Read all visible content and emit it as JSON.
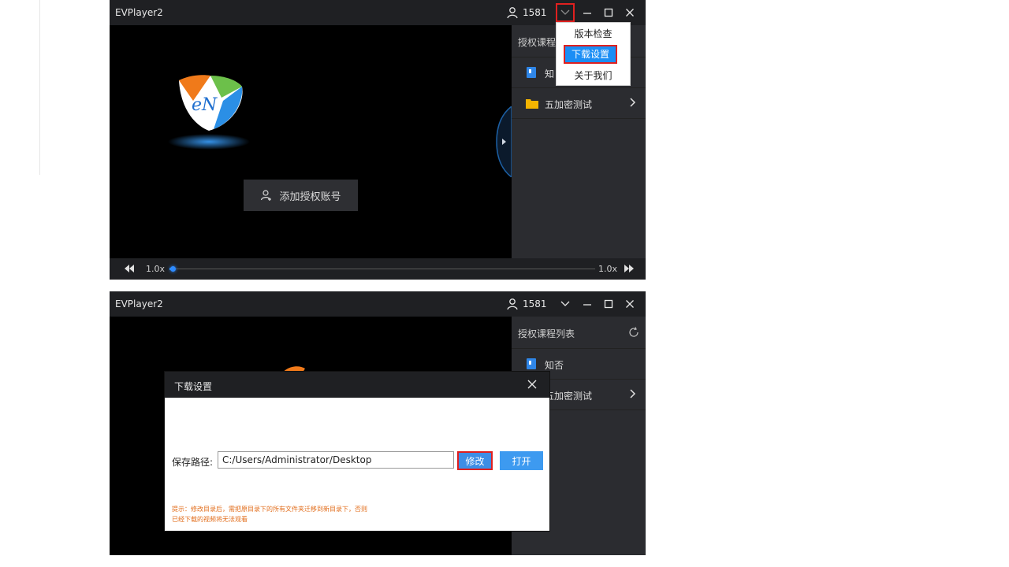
{
  "app": {
    "title": "EVPlayer2",
    "user_count": "1581"
  },
  "menu": {
    "items": [
      "版本检查",
      "下载设置",
      "关于我们"
    ]
  },
  "panel": {
    "title": "授权课程列表",
    "title_truncated": "授权课程",
    "items": [
      {
        "label": "知否",
        "label_truncated": "知",
        "icon": "book-icon"
      },
      {
        "label": "五加密测试",
        "icon": "folder-icon"
      }
    ]
  },
  "video": {
    "add_account_label": "添加授权账号"
  },
  "playbar": {
    "speed_left": "1.0x",
    "speed_right": "1.0x",
    "progress": 0.0
  },
  "dialog": {
    "title": "下载设置",
    "path_label": "保存路径:",
    "path_value": "C:/Users/Administrator/Desktop",
    "modify_label": "修改",
    "open_label": "打开",
    "tip_line1": "提示：修改目录后，需把原目录下的所有文件夹迁移到新目录下，否则",
    "tip_line2": "已经下载的视频将无法观看"
  },
  "colors": {
    "accent": "#1b8ef5",
    "highlight_box": "#e0201f",
    "tip": "#e26d1b",
    "titlebar": "#1f2023",
    "panel": "#2b2c30"
  }
}
